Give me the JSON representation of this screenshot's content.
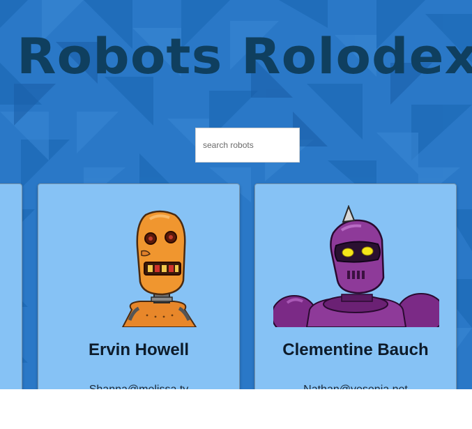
{
  "app": {
    "title": "Robots Rolodex"
  },
  "search": {
    "placeholder": "search robots"
  },
  "cards": [
    {
      "name": "",
      "email": "",
      "robot_icon": "robot-avatar"
    },
    {
      "name": "Ervin Howell",
      "email": "Shanna@melissa.tv",
      "robot_icon": "orange-robot-avatar"
    },
    {
      "name": "Clementine Bauch",
      "email": "Nathan@yesenia.net",
      "robot_icon": "purple-robot-avatar"
    }
  ],
  "colors": {
    "background": "#2a78c7",
    "title": "#0f3f5f",
    "card": "#86c2f5",
    "card_border": "#7a95aa"
  }
}
